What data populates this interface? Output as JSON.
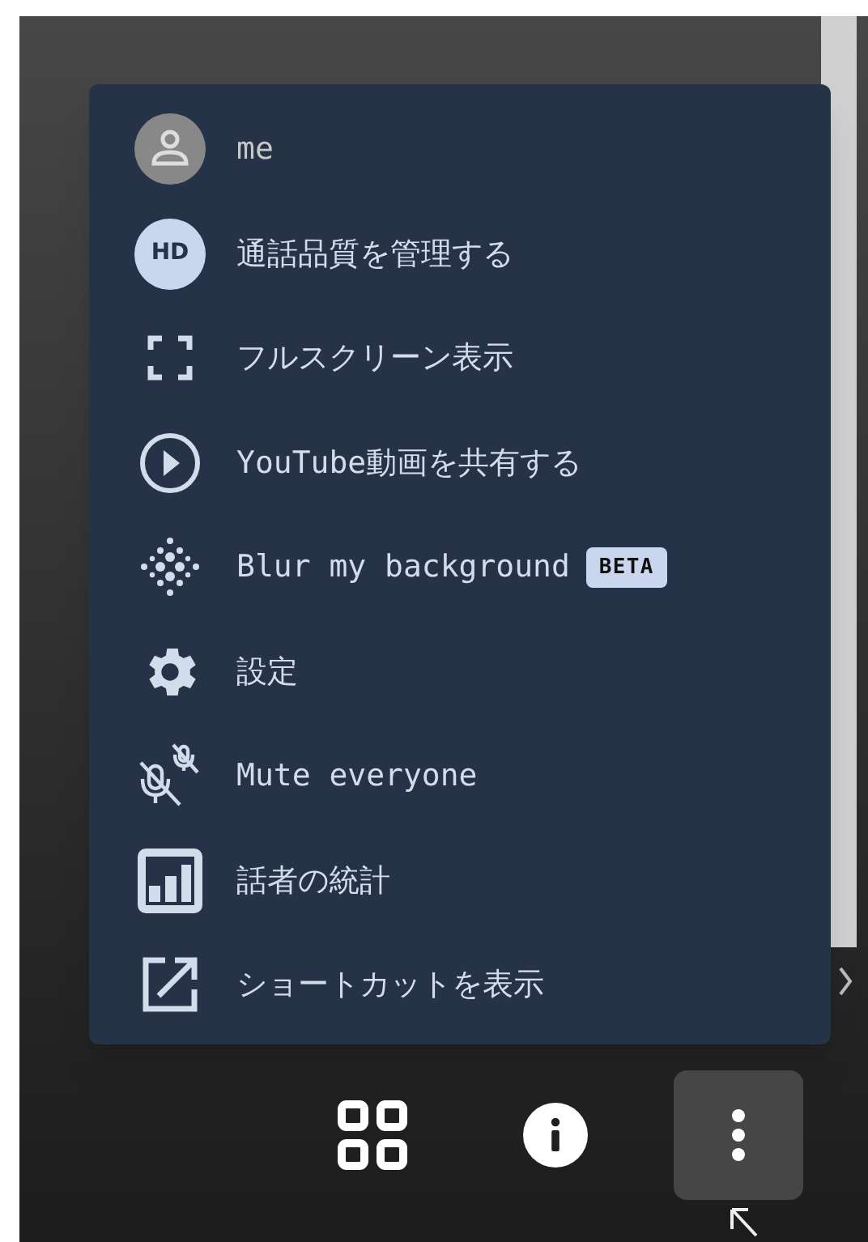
{
  "menu": {
    "items": [
      {
        "kind": "avatar",
        "label": "me"
      },
      {
        "kind": "badge",
        "badge": "HD",
        "label": "通話品質を管理する"
      },
      {
        "kind": "icon",
        "label": "フルスクリーン表示"
      },
      {
        "kind": "icon",
        "label": "YouTube動画を共有する"
      },
      {
        "kind": "icon",
        "label": "Blur my background",
        "tag": "BETA"
      },
      {
        "kind": "icon",
        "label": "設定"
      },
      {
        "kind": "icon",
        "label": "Mute everyone"
      },
      {
        "kind": "icon",
        "label": "話者の統計"
      },
      {
        "kind": "icon",
        "label": "ショートカットを表示"
      }
    ]
  },
  "toolbar": [
    {
      "selected": false
    },
    {
      "selected": false
    },
    {
      "selected": true
    }
  ]
}
